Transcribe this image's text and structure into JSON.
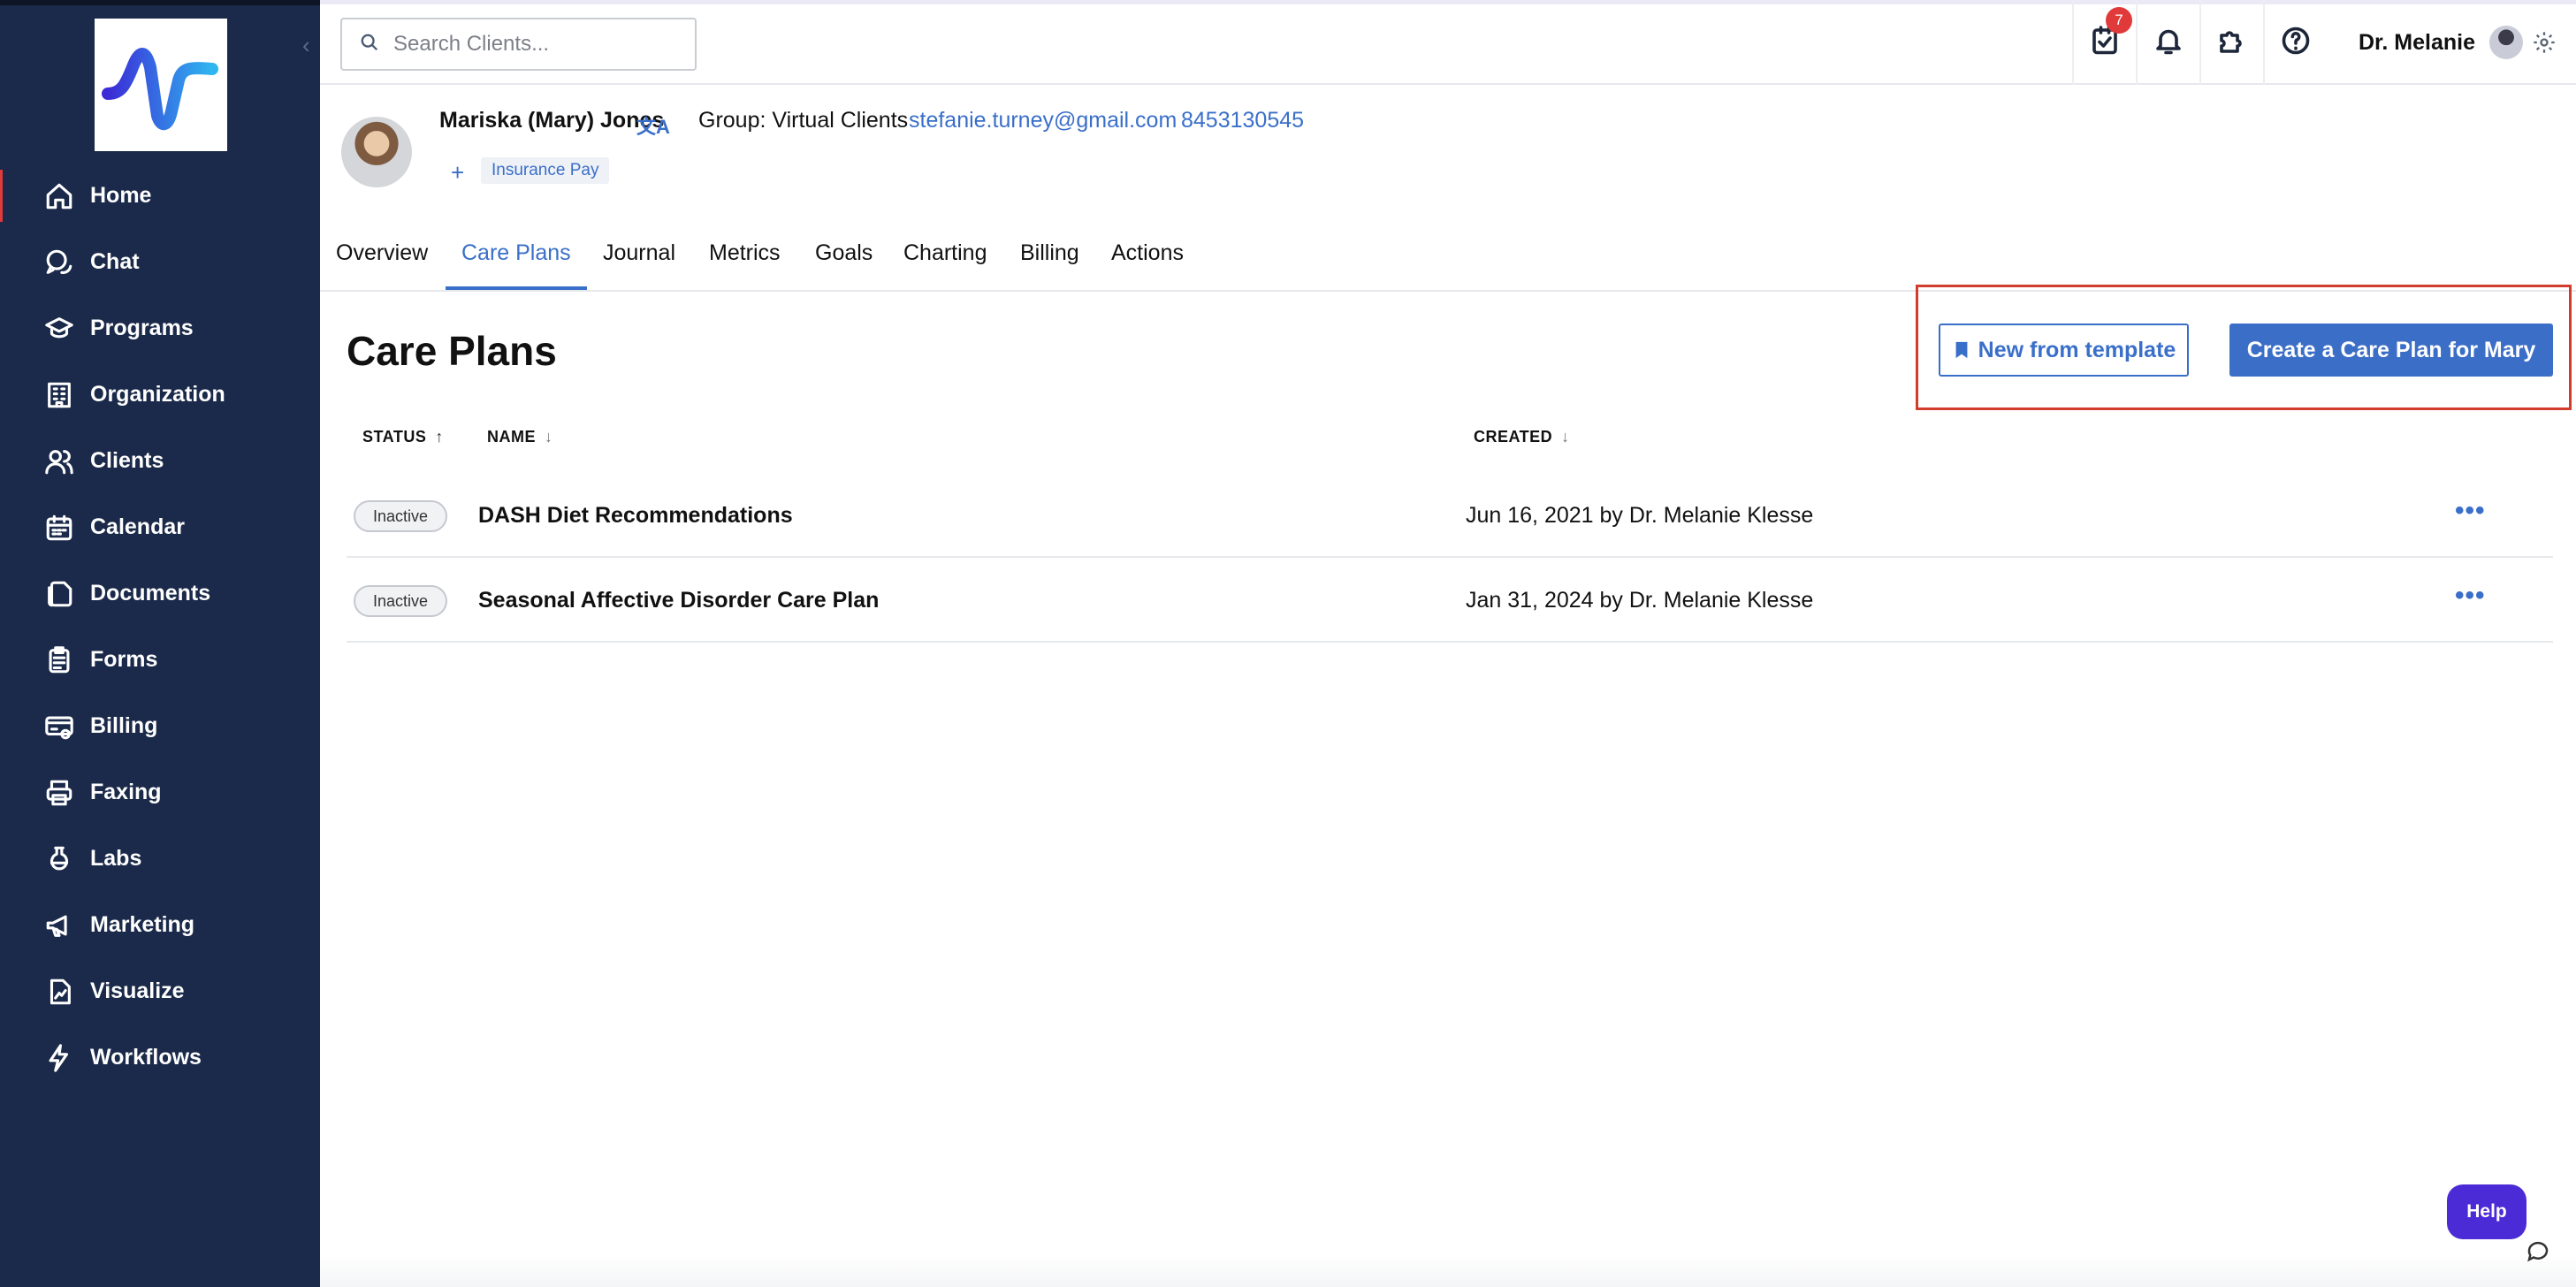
{
  "sidebar": {
    "items": [
      {
        "label": "Home",
        "icon": "home-icon"
      },
      {
        "label": "Chat",
        "icon": "chat-icon"
      },
      {
        "label": "Programs",
        "icon": "graduation-cap-icon"
      },
      {
        "label": "Organization",
        "icon": "building-icon"
      },
      {
        "label": "Clients",
        "icon": "users-icon"
      },
      {
        "label": "Calendar",
        "icon": "calendar-icon"
      },
      {
        "label": "Documents",
        "icon": "documents-icon"
      },
      {
        "label": "Forms",
        "icon": "clipboard-icon"
      },
      {
        "label": "Billing",
        "icon": "billing-icon"
      },
      {
        "label": "Faxing",
        "icon": "printer-icon"
      },
      {
        "label": "Labs",
        "icon": "flask-icon"
      },
      {
        "label": "Marketing",
        "icon": "megaphone-icon"
      },
      {
        "label": "Visualize",
        "icon": "chart-file-icon"
      },
      {
        "label": "Workflows",
        "icon": "lightning-icon"
      }
    ]
  },
  "topbar": {
    "search_placeholder": "Search Clients...",
    "tasks_badge": "7",
    "user_name": "Dr. Melanie"
  },
  "client": {
    "name": "Mariska (Mary) Jones",
    "group": "Group: Virtual Clients",
    "email": "stefanie.turney@gmail.com",
    "phone": "8453130545",
    "add_symbol": "+",
    "tag": "Insurance Pay"
  },
  "tabs": [
    "Overview",
    "Care Plans",
    "Journal",
    "Metrics",
    "Goals",
    "Charting",
    "Billing",
    "Actions"
  ],
  "page": {
    "title": "Care Plans",
    "new_from_template": "New from template",
    "create_button": "Create a Care Plan for Mary"
  },
  "table": {
    "headers": {
      "status": "STATUS",
      "name": "NAME",
      "created": "CREATED"
    },
    "rows": [
      {
        "status": "Inactive",
        "name": "DASH Diet Recommendations",
        "created": "Jun 16, 2021 by Dr. Melanie Klesse",
        "menu": "•••"
      },
      {
        "status": "Inactive",
        "name": "Seasonal Affective Disorder Care Plan",
        "created": "Jan 31, 2024 by Dr. Melanie Klesse",
        "menu": "•••"
      }
    ]
  },
  "help_label": "Help",
  "colors": {
    "sidebar": "#1b2a4a",
    "accent": "#3a6fc9",
    "highlight": "#d23c2c",
    "help": "#4b2bd6"
  }
}
